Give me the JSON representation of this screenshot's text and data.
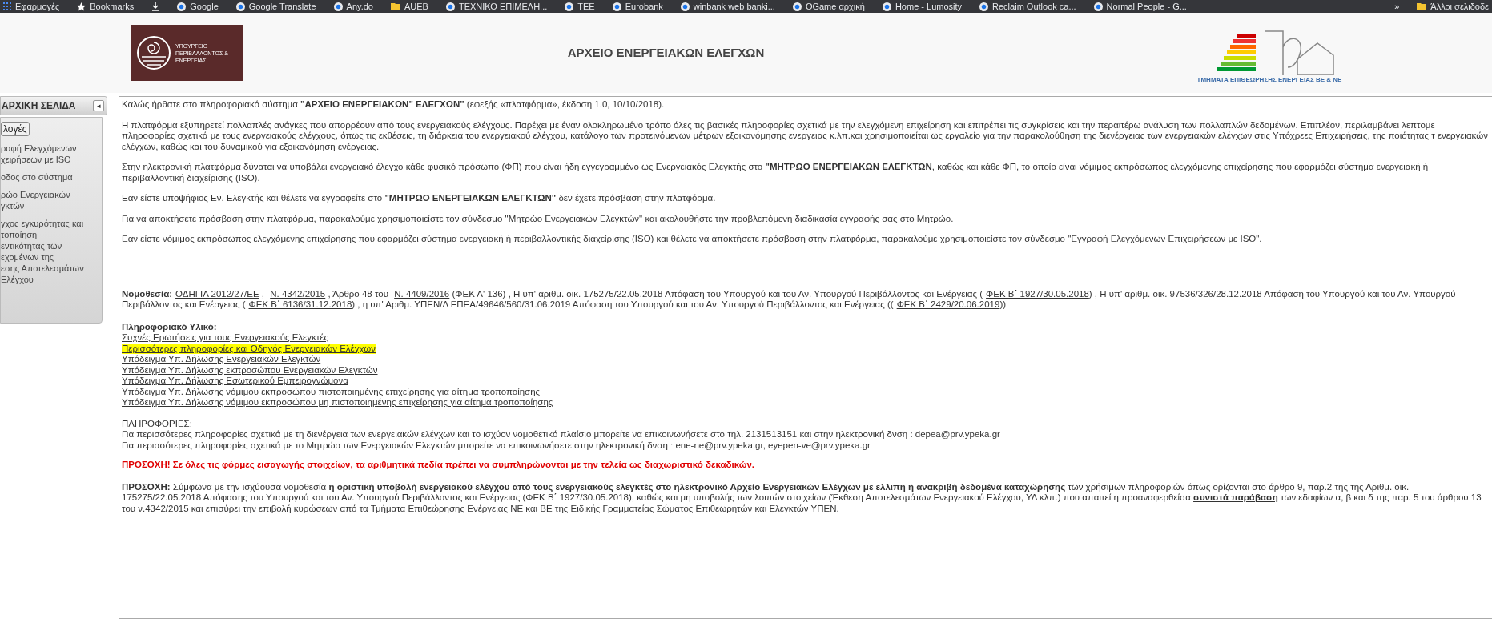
{
  "bookmarks_bar": {
    "items": [
      {
        "label": "Εφαρμογές",
        "kind": "apps"
      },
      {
        "label": "Bookmarks",
        "kind": "star"
      },
      {
        "kind": "download"
      },
      {
        "label": "Google",
        "kind": "site"
      },
      {
        "label": "Google Translate",
        "kind": "site"
      },
      {
        "label": "Any.do",
        "kind": "site"
      },
      {
        "label": "AUEB",
        "kind": "folder"
      },
      {
        "label": "ΤΕΧΝΙΚΟ ΕΠΙΜΕΛΗ...",
        "kind": "site"
      },
      {
        "label": "ΤΕΕ",
        "kind": "site"
      },
      {
        "label": "Eurobank",
        "kind": "site"
      },
      {
        "label": "winbank web banki...",
        "kind": "site"
      },
      {
        "label": "OGame αρχική",
        "kind": "site"
      },
      {
        "label": "Home - Lumosity",
        "kind": "site"
      },
      {
        "label": "Reclaim Outlook ca...",
        "kind": "site"
      },
      {
        "label": "Normal People - G...",
        "kind": "site"
      }
    ],
    "more": "»",
    "other": "Άλλοι σελιδοδε"
  },
  "header": {
    "ministry_logo_text": "ΥΠΟΥΡΓΕΙΟ ΠΕΡΙΒΑΛΛΟΝΤΟΣ & ΕΝΕΡΓΕΙΑΣ",
    "title": "ΑΡΧΕΙΟ ΕΝΕΡΓΕΙΑΚΩΝ ΕΛΕΓΧΩΝ",
    "inspection_logo_text": "ΤΜΗΜΑΤΑ ΕΠΙΘΕΩΡΗΣΗΣ ΕΝΕΡΓΕΙΑΣ ΒΕ & ΝΕ"
  },
  "sidebar": {
    "title": "ΑΡΧΙΚΗ ΣΕΛΙΔΑ",
    "collapse": "◂",
    "options_button": "λογές",
    "items": [
      {
        "lines": [
          "ραφή Ελεγχόμενων",
          "χειρήσεων με ISO"
        ]
      },
      {
        "lines": [
          "οδος στο σύστημα"
        ]
      },
      {
        "lines": [
          "ρώο Ενεργειακών",
          "γκτών"
        ]
      },
      {
        "lines": [
          "γχος εγκυρότητας και",
          "τοποίηση",
          "εντικότητας των",
          "εχομένων της",
          "εσης Αποτελεσμάτων",
          "Ελέγχου"
        ]
      }
    ]
  },
  "content": {
    "paragraphs": [
      {
        "kind": "plain",
        "segments": [
          {
            "kind": "text",
            "text": "Καλώς ήρθατε στο πληροφοριακό σύστημα "
          },
          {
            "kind": "bold",
            "text": "\"ΑΡΧΕΙΟ ΕΝΕΡΓΕΙΑΚΩΝ\" ΕΛΕΓΧΩΝ\""
          },
          {
            "kind": "text",
            "text": " (εφεξής «πλατφόρμα», έκδοση 1.0, 10/10/2018)."
          }
        ]
      },
      {
        "kind": "plain",
        "segments": [
          {
            "kind": "text",
            "text": "Η πλατφόρμα εξυπηρετεί πολλαπλές ανάγκες που απορρέουν από τους ενεργειακούς ελέγχους. Παρέχει με έναν ολοκληρωμένο τρόπο όλες τις βασικές πληροφορίες σχετικά με την ελεγχόμενη επιχείρηση και επιτρέπει τις συγκρίσεις και την περαιτέρω ανάλυση των πολλαπλών δεδομένων. Επιπλέον, περιλαμβάνει λεπτομε πληροφορίες σχετικά με τους ενεργειακούς ελέγχους, όπως τις εκθέσεις, τη διάρκεια του ενεργειακού ελέγχου, κατάλογο των προτεινόμενων μέτρων εξοικονόμησης ενεργειας κ.λπ.και χρησιμοποιείται ως εργαλείο για την παρακολούθηση της διενέργειας των ενεργειακών ελέγχων στις Υπόχρεες Επιχειρήσεις, της ποιότητας τ ενεργειακών ελέγχων, καθώς και του δυναμικού για εξοικονόμηση ενέργειας."
          }
        ]
      },
      {
        "kind": "plain",
        "segments": [
          {
            "kind": "text",
            "text": "Στην ηλεκτρονική πλατφόρμα δύναται να υποβάλει ενεργειακό έλεγχο κάθε φυσικό πρόσωπο (ΦΠ) που είναι ήδη εγγεγραμμένο ως Ενεργειακός Ελεγκτής στο "
          },
          {
            "kind": "bold",
            "text": "\"ΜΗΤΡΩΟ ΕΝΕΡΓΕΙΑΚΩΝ ΕΛΕΓΚΤΩΝ"
          },
          {
            "kind": "text",
            "text": ", καθώς και κάθε ΦΠ, το οποίο είναι νόμιμος εκπρόσωπος ελεγχόμενης επιχείρησης που εφαρμόζει σύστημα ενεργειακή ή περιβαλλοντική διαχείρισης (ISO)."
          }
        ]
      },
      {
        "kind": "plain",
        "segments": [
          {
            "kind": "text",
            "text": "Εαν είστε υποψήφιος Εν. Ελεγκτής και θέλετε να εγγραφείτε στο "
          },
          {
            "kind": "bold",
            "text": "\"ΜΗΤΡΩΟ ΕΝΕΡΓΕΙΑΚΩΝ ΕΛΕΓΚΤΩΝ\""
          },
          {
            "kind": "text",
            "text": " δεν έχετε πρόσβαση στην πλατφόρμα."
          }
        ]
      },
      {
        "kind": "plain",
        "segments": [
          {
            "kind": "text",
            "text": "Για να αποκτήσετε πρόσβαση στην πλατφόρμα, παρακαλούμε χρησιμοποιείστε τον σύνδεσμο \"Μητρώο Ενεργειακών Ελεγκτών\" και ακολουθήστε την προβλεπόμενη διαδικασία εγγραφής σας στο Μητρώο."
          }
        ]
      },
      {
        "kind": "plain",
        "segments": [
          {
            "kind": "text",
            "text": "Εαν είστε νόμιμος εκπρόσωπος ελεγχόμενης επιχείρησης που εφαρμόζει σύστημα ενεργειακή ή περιβαλλοντικής διαχείρισης (ISO) και θέλετε να αποκτήσετε πρόσβαση στην πλατφόρμα, παρακαλούμε χρησιμοποιείστε τον σύνδεσμο \"Εγγραφή Ελεγχόμενων Επιχειρήσεων με ISO\"."
          }
        ]
      },
      {
        "kind": "legislation",
        "segments": [
          {
            "kind": "bold",
            "text": "Νομοθεσία:"
          },
          {
            "kind": "link",
            "text": "ΟΔΗΓΙΑ 2012/27/ΕΕ"
          },
          {
            "kind": "text",
            "text": " ,  "
          },
          {
            "kind": "link",
            "text": "Ν. 4342/2015"
          },
          {
            "kind": "text",
            "text": " ,  Άρθρο 48 του "
          },
          {
            "kind": "link",
            "text": "Ν. 4409/2016"
          },
          {
            "kind": "text",
            "text": " (ΦΕΚ Α' 136) ,  Η υπ' αριθμ. οικ. 175275/22.05.2018 Απόφαση του Υπουργού και του Αν. Υπουργού Περιβάλλοντος και Ενέργειας ("
          },
          {
            "kind": "link",
            "text": "ΦΕΚ Β΄ 1927/30.05.2018"
          },
          {
            "kind": "text",
            "text": ") ,  Η υπ' αριθμ. οικ. 97536/326/28.12.2018 Απόφαση του Υπουργού και του Αν. Υπουργού Περιβάλλοντος και Ενέργειας ("
          },
          {
            "kind": "link",
            "text": "ΦΕΚ Β΄ 6136/31.12.2018"
          },
          {
            "kind": "text",
            "text": ") ,  η υπ' Αριθμ. ΥΠΕΝ/Δ ΕΠΕΑ/49646/560/31.06.2019 Απόφαση του Υπουργού και του Αν. Υπουργού Περιβάλλοντος και Ενέργειας (("
          },
          {
            "kind": "link",
            "text": "ΦΕΚ Β΄ 2429/20.06.2019"
          },
          {
            "kind": "text",
            "text": "))"
          }
        ]
      }
    ],
    "info_material": {
      "title": "Πληροφοριακό Υλικό:",
      "links": [
        {
          "text": "Συχνές Ερωτήσεις για τους Ενεργειακούς Ελεγκτές",
          "highlighted": false
        },
        {
          "text": "Περισσότερες πληροφορίες και Οδηγός Ενεργειακών Ελέγχων",
          "highlighted": true
        },
        {
          "text": "Υπόδειγμα Υπ. Δήλωσης Ενεργειακών Ελεγκτών",
          "highlighted": false
        },
        {
          "text": "Υπόδειγμα Υπ. Δήλωσης εκπροσώπου Ενεργειακών Ελεγκτών",
          "highlighted": false
        },
        {
          "text": "Υπόδειγμα Υπ. Δήλωσης Εσωτερικού Εμπειρογνώμονα",
          "highlighted": false
        },
        {
          "text": "Υπόδειγμα Υπ. Δήλωσης νόμιμου εκπροσώπου πιστοποιημένης επιχείρησης για αίτημα τροποποίησης",
          "highlighted": false
        },
        {
          "text": "Υπόδειγμα Υπ. Δήλωσης νόμιμου εκπροσώπου μη πιστοποιημένης επιχείρησης για αίτημα τροποποίησης",
          "highlighted": false
        }
      ]
    },
    "contact": {
      "title": "ΠΛΗΡΟΦΟΡΙΕΣ:",
      "lines": [
        "Για περισσότερες πληροφορίες σχετικά με τη διενέργεια των ενεργειακών ελέγχων και το ισχύον νομοθετικό πλαίσιο μπορείτε να επικοινωνήσετε στο τηλ. 2131513151 και στην ηλεκτρονική δνση : depea@prv.ypeka.gr",
        "Για περισσότερες πληροφορίες σχετικά με το Μητρώο των Ενεργειακών Ελεγκτών μπορείτε να επικοινωνήσετε στην ηλεκτρονική δνση : ene-ne@prv.ypeka.gr, eyepen-ve@prv.ypeka.gr"
      ]
    },
    "warning": "ΠΡΟΣΟΧΗ! Σε όλες τις φόρμες εισαγωγής στοιχείων, τα αριθμητικά πεδία πρέπει να συμπληρώνονται με την τελεία ως διαχωριστικό δεκαδικών.",
    "notice": [
      {
        "kind": "bold",
        "text": "ΠΡΟΣΟΧΗ:"
      },
      {
        "kind": "text",
        "text": " Σύμφωνα με την ισχύουσα νομοθεσία "
      },
      {
        "kind": "bold",
        "text": "η οριστική υποβολή ενεργειακού ελέγχου από τους ενεργειακούς ελεγκτές στο ηλεκτρονικό Αρχείο Ενεργειακών Ελέγχων με ελλιπή ή ανακριβή δεδομένα καταχώρησης"
      },
      {
        "kind": "text",
        "text": " των χρήσιμων πληροφοριών όπως ορίζονται στο άρθρο 9, παρ.2 της της Αριθμ. οικ. 175275/22.05.2018 Απόφασης του Υπουργού και του Αν. Υπουργού Περιβάλλοντος και Ενέργειας (ΦΕΚ Β΄ 1927/30.05.2018), καθώς και μη υποβολής των λοιπών στοιχείων (Έκθεση Αποτελεσμάτων Ενεργειακού Ελέγχου, ΥΔ κλπ.) που απαιτεί η προαναφερθείσα "
      },
      {
        "kind": "strong_underline",
        "text": "συνιστά παράβαση"
      },
      {
        "kind": "text",
        "text": " των εδαφίων α, β και δ της παρ. 5 του άρθρου 13 του ν.4342/2015 και επισύρει την επιβολή κυρώσεων από τα Τμήματα Επιθεώρησης Ενέργειας ΝΕ και ΒΕ της Ειδικής Γραμματείας Σώματος Επιθεωρητών και Ελεγκτών ΥΠΕΝ."
      }
    ]
  }
}
